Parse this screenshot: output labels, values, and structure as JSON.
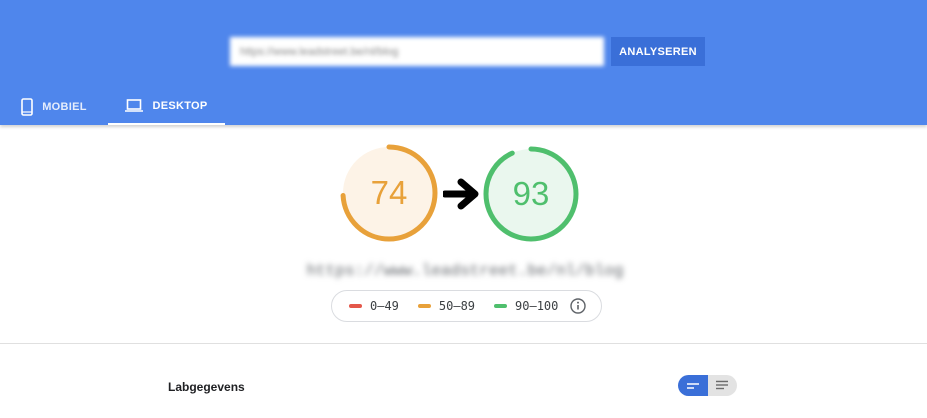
{
  "search": {
    "url_value": "https://www.leadstreet.be/nl/blog",
    "button_label": "ANALYSEREN"
  },
  "tabs": [
    {
      "label": "MOBIEL",
      "icon": "smartphone-icon",
      "selected": false
    },
    {
      "label": "DESKTOP",
      "icon": "laptop-icon",
      "selected": true
    }
  ],
  "scores": {
    "before": {
      "value": 74,
      "fraction": 0.74,
      "color": "#e8a13a",
      "track": "#fdf3e7"
    },
    "after": {
      "value": 93,
      "fraction": 0.93,
      "color": "#4fbf6d",
      "track": "#eaf7ee"
    },
    "arrow_icon": "right-arrow-icon"
  },
  "analysed_url": "https://www.leadstreet.be/nl/blog",
  "legend": [
    {
      "label": "0–49",
      "color": "#e4574a"
    },
    {
      "label": "50–89",
      "color": "#e8a13a"
    },
    {
      "label": "90–100",
      "color": "#4fbf6d"
    }
  ],
  "section": {
    "title": "Labgegevens"
  },
  "colors": {
    "header": "#4f86ec",
    "button": "#3a6fd8"
  }
}
